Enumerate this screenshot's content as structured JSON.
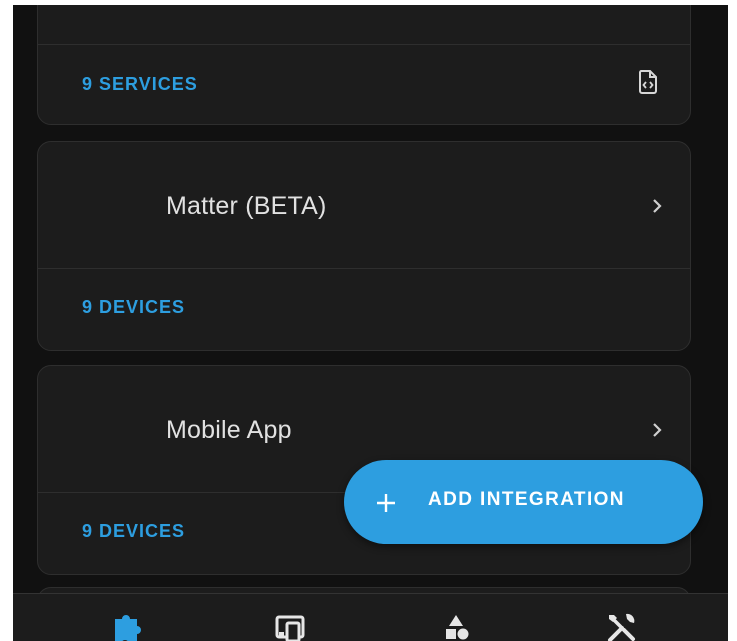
{
  "cards": [
    {
      "footer_link": "9 SERVICES",
      "footer_icon": "file-code-icon"
    },
    {
      "title": "Matter (BETA)",
      "footer_link": "9 DEVICES",
      "chevron_icon": "chevron-right-icon"
    },
    {
      "title": "Mobile App",
      "footer_link": "9 DEVICES",
      "chevron_icon": "chevron-right-icon"
    }
  ],
  "fab": {
    "label": "ADD INTEGRATION",
    "icon": "plus-icon"
  },
  "bottom_nav": {
    "items": [
      {
        "icon": "puzzle-icon",
        "active": true
      },
      {
        "icon": "devices-icon",
        "active": false
      },
      {
        "icon": "shapes-icon",
        "active": false
      },
      {
        "icon": "tools-icon",
        "active": false
      }
    ]
  },
  "colors": {
    "accent": "#2d9ee0",
    "background": "#111111",
    "card": "#1c1c1c",
    "text": "#e1e1e1"
  }
}
